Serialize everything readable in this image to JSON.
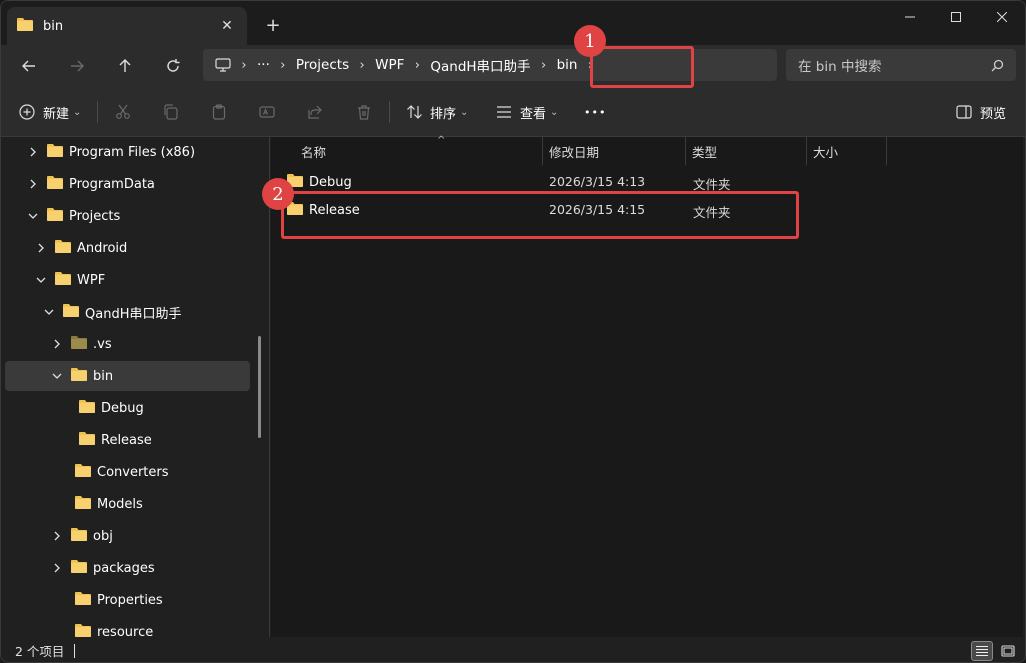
{
  "tab": {
    "title": "bin",
    "close_glyph": "✕",
    "new_glyph": "+"
  },
  "address": {
    "crumbs": [
      "Projects",
      "WPF",
      "QandH串口助手",
      "bin"
    ],
    "ellipsis": "···"
  },
  "search": {
    "placeholder": "在 bin 中搜索"
  },
  "toolbar": {
    "new_label": "新建",
    "sort_label": "排序",
    "view_label": "查看",
    "more_glyph": "•••",
    "preview_label": "预览"
  },
  "sidebar": {
    "items": [
      {
        "label": "Program Files (x86)",
        "chevron": "right"
      },
      {
        "label": "ProgramData",
        "chevron": "right"
      },
      {
        "label": "Projects",
        "chevron": "down"
      },
      {
        "label": "Android",
        "chevron": "right"
      },
      {
        "label": "WPF",
        "chevron": "down"
      },
      {
        "label": "QandH串口助手",
        "chevron": "down"
      },
      {
        "label": ".vs",
        "chevron": "right"
      },
      {
        "label": "bin",
        "chevron": "down",
        "selected": true
      },
      {
        "label": "Debug",
        "chevron": "none"
      },
      {
        "label": "Release",
        "chevron": "none"
      },
      {
        "label": "Converters",
        "chevron": "none"
      },
      {
        "label": "Models",
        "chevron": "none"
      },
      {
        "label": "obj",
        "chevron": "right"
      },
      {
        "label": "packages",
        "chevron": "right"
      },
      {
        "label": "Properties",
        "chevron": "none"
      },
      {
        "label": "resource",
        "chevron": "none"
      }
    ]
  },
  "columns": {
    "name": "名称",
    "date": "修改日期",
    "type": "类型",
    "size": "大小"
  },
  "files": [
    {
      "name": "Debug",
      "date": "2026/3/15 4:13",
      "type": "文件夹",
      "size": ""
    },
    {
      "name": "Release",
      "date": "2026/3/15 4:15",
      "type": "文件夹",
      "size": ""
    }
  ],
  "status": {
    "count_text": "2 个项目"
  },
  "annotations": {
    "badge1": "1",
    "badge2": "2",
    "color": "#e04343"
  },
  "colors": {
    "folder": "#f2c14e",
    "folder_dim": "#8b7a3e",
    "accent": "#e04343"
  }
}
